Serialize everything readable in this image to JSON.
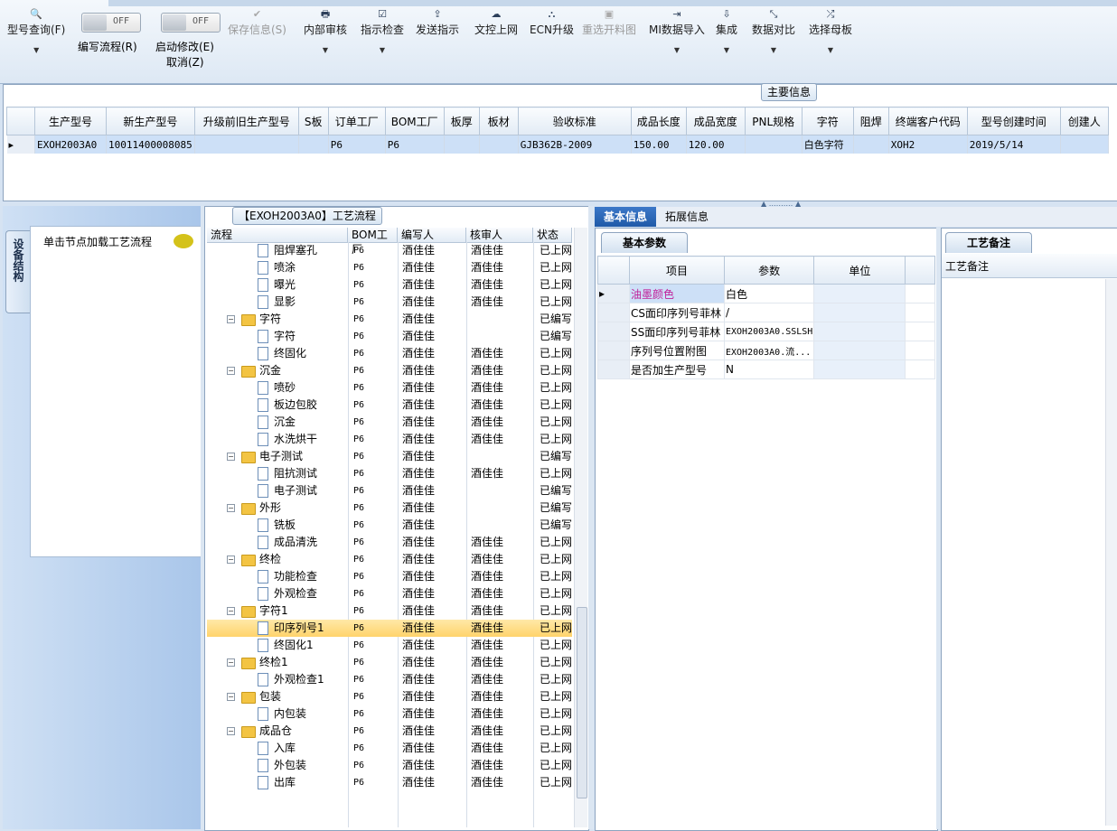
{
  "toolbar": {
    "buttons": [
      {
        "label": "型号查询(F)",
        "icon": "search-icon",
        "glyph": "🔍",
        "dropdown": true,
        "disabled": false
      },
      {
        "label": "保存信息(S)",
        "icon": "check-icon",
        "glyph": "✔",
        "dropdown": false,
        "disabled": true
      },
      {
        "label": "内部审核",
        "icon": "print-icon",
        "glyph": "🖶",
        "dropdown": true,
        "disabled": false
      },
      {
        "label": "指示检查",
        "icon": "checkbox-icon",
        "glyph": "☑",
        "dropdown": true,
        "disabled": false
      },
      {
        "label": "发送指示",
        "icon": "upload-icon",
        "glyph": "⇪",
        "dropdown": false,
        "disabled": false
      },
      {
        "label": "文控上网",
        "icon": "cloud-upload-icon",
        "glyph": "☁",
        "dropdown": false,
        "disabled": false
      },
      {
        "label": "ECN升级",
        "icon": "ecn-icon",
        "glyph": "⛬",
        "dropdown": false,
        "disabled": false
      },
      {
        "label": "重选开料图",
        "icon": "image-icon",
        "glyph": "▣",
        "dropdown": false,
        "disabled": true
      },
      {
        "label": "MI数据导入",
        "icon": "import-icon",
        "glyph": "⇥",
        "dropdown": true,
        "disabled": false
      },
      {
        "label": "集成",
        "icon": "download-icon",
        "glyph": "⇩",
        "dropdown": true,
        "disabled": false
      },
      {
        "label": "数据对比",
        "icon": "compress-icon",
        "glyph": "⤡",
        "dropdown": true,
        "disabled": false
      },
      {
        "label": "选择母板",
        "icon": "shuffle-icon",
        "glyph": "⤮",
        "dropdown": true,
        "disabled": false
      }
    ],
    "toggles": [
      {
        "state": "OFF",
        "label": "编写流程(R)"
      },
      {
        "state": "OFF",
        "label": "启动修改(E)",
        "sublabel": "取消(Z)"
      }
    ]
  },
  "main_info": {
    "group_title": "主要信息",
    "columns": [
      "生产型号",
      "新生产型号",
      "升级前旧生产型号",
      "S板",
      "订单工厂",
      "BOM工厂",
      "板厚",
      "板材",
      "验收标准",
      "成品长度",
      "成品宽度",
      "PNL规格",
      "字符",
      "阻焊",
      "终端客户代码",
      "型号创建时间",
      "创建人"
    ],
    "row": [
      "EXOH2003A0",
      "10011400008085",
      "",
      "",
      "P6",
      "P6",
      "",
      "",
      "GJB362B-2009",
      "150.00",
      "120.00",
      "",
      "白色字符",
      "",
      "XOH2",
      "2019/5/14",
      ""
    ]
  },
  "left_panel": {
    "vertical_tab": "设备结构",
    "hint": "单击节点加载工艺流程"
  },
  "process_tree": {
    "title": "【EXOH2003A0】工艺流程",
    "columns": [
      "流程",
      "BOM工厂",
      "编写人",
      "核审人",
      "状态"
    ],
    "rows": [
      {
        "name": "阻焊塞孔",
        "level": 2,
        "bom": "P6",
        "writer": "酒佳佳",
        "reviewer": "酒佳佳",
        "status": "已上网"
      },
      {
        "name": "喷涂",
        "level": 2,
        "bom": "P6",
        "writer": "酒佳佳",
        "reviewer": "酒佳佳",
        "status": "已上网"
      },
      {
        "name": "曝光",
        "level": 2,
        "bom": "P6",
        "writer": "酒佳佳",
        "reviewer": "酒佳佳",
        "status": "已上网"
      },
      {
        "name": "显影",
        "level": 2,
        "bom": "P6",
        "writer": "酒佳佳",
        "reviewer": "酒佳佳",
        "status": "已上网"
      },
      {
        "name": "字符",
        "level": 1,
        "bom": "P6",
        "writer": "酒佳佳",
        "reviewer": "",
        "status": "已编写"
      },
      {
        "name": "字符",
        "level": 2,
        "bom": "P6",
        "writer": "酒佳佳",
        "reviewer": "",
        "status": "已编写"
      },
      {
        "name": "终固化",
        "level": 2,
        "bom": "P6",
        "writer": "酒佳佳",
        "reviewer": "酒佳佳",
        "status": "已上网"
      },
      {
        "name": "沉金",
        "level": 1,
        "bom": "P6",
        "writer": "酒佳佳",
        "reviewer": "酒佳佳",
        "status": "已上网"
      },
      {
        "name": "喷砂",
        "level": 2,
        "bom": "P6",
        "writer": "酒佳佳",
        "reviewer": "酒佳佳",
        "status": "已上网"
      },
      {
        "name": "板边包胶",
        "level": 2,
        "bom": "P6",
        "writer": "酒佳佳",
        "reviewer": "酒佳佳",
        "status": "已上网"
      },
      {
        "name": "沉金",
        "level": 2,
        "bom": "P6",
        "writer": "酒佳佳",
        "reviewer": "酒佳佳",
        "status": "已上网"
      },
      {
        "name": "水洗烘干",
        "level": 2,
        "bom": "P6",
        "writer": "酒佳佳",
        "reviewer": "酒佳佳",
        "status": "已上网"
      },
      {
        "name": "电子测试",
        "level": 1,
        "bom": "P6",
        "writer": "酒佳佳",
        "reviewer": "",
        "status": "已编写"
      },
      {
        "name": "阻抗测试",
        "level": 2,
        "bom": "P6",
        "writer": "酒佳佳",
        "reviewer": "酒佳佳",
        "status": "已上网"
      },
      {
        "name": "电子测试",
        "level": 2,
        "bom": "P6",
        "writer": "酒佳佳",
        "reviewer": "",
        "status": "已编写"
      },
      {
        "name": "外形",
        "level": 1,
        "bom": "P6",
        "writer": "酒佳佳",
        "reviewer": "",
        "status": "已编写"
      },
      {
        "name": "铣板",
        "level": 2,
        "bom": "P6",
        "writer": "酒佳佳",
        "reviewer": "",
        "status": "已编写"
      },
      {
        "name": "成品清洗",
        "level": 2,
        "bom": "P6",
        "writer": "酒佳佳",
        "reviewer": "酒佳佳",
        "status": "已上网"
      },
      {
        "name": "终检",
        "level": 1,
        "bom": "P6",
        "writer": "酒佳佳",
        "reviewer": "酒佳佳",
        "status": "已上网"
      },
      {
        "name": "功能检查",
        "level": 2,
        "bom": "P6",
        "writer": "酒佳佳",
        "reviewer": "酒佳佳",
        "status": "已上网"
      },
      {
        "name": "外观检查",
        "level": 2,
        "bom": "P6",
        "writer": "酒佳佳",
        "reviewer": "酒佳佳",
        "status": "已上网"
      },
      {
        "name": "字符1",
        "level": 1,
        "bom": "P6",
        "writer": "酒佳佳",
        "reviewer": "酒佳佳",
        "status": "已上网"
      },
      {
        "name": "印序列号1",
        "level": 2,
        "bom": "P6",
        "writer": "酒佳佳",
        "reviewer": "酒佳佳",
        "status": "已上网",
        "selected": true
      },
      {
        "name": "终固化1",
        "level": 2,
        "bom": "P6",
        "writer": "酒佳佳",
        "reviewer": "酒佳佳",
        "status": "已上网"
      },
      {
        "name": "终检1",
        "level": 1,
        "bom": "P6",
        "writer": "酒佳佳",
        "reviewer": "酒佳佳",
        "status": "已上网"
      },
      {
        "name": "外观检查1",
        "level": 2,
        "bom": "P6",
        "writer": "酒佳佳",
        "reviewer": "酒佳佳",
        "status": "已上网"
      },
      {
        "name": "包装",
        "level": 1,
        "bom": "P6",
        "writer": "酒佳佳",
        "reviewer": "酒佳佳",
        "status": "已上网"
      },
      {
        "name": "内包装",
        "level": 2,
        "bom": "P6",
        "writer": "酒佳佳",
        "reviewer": "酒佳佳",
        "status": "已上网"
      },
      {
        "name": "成品仓",
        "level": 1,
        "bom": "P6",
        "writer": "酒佳佳",
        "reviewer": "酒佳佳",
        "status": "已上网"
      },
      {
        "name": "入库",
        "level": 2,
        "bom": "P6",
        "writer": "酒佳佳",
        "reviewer": "酒佳佳",
        "status": "已上网"
      },
      {
        "name": "外包装",
        "level": 2,
        "bom": "P6",
        "writer": "酒佳佳",
        "reviewer": "酒佳佳",
        "status": "已上网"
      },
      {
        "name": "出库",
        "level": 2,
        "bom": "P6",
        "writer": "酒佳佳",
        "reviewer": "酒佳佳",
        "status": "已上网"
      }
    ]
  },
  "right_panel": {
    "tabs": [
      "基本信息",
      "拓展信息"
    ],
    "basic_params_tab": "基本参数",
    "param_columns": [
      "项目",
      "参数",
      "单位"
    ],
    "params": [
      {
        "item": "油墨颜色",
        "value": "白色",
        "unit": "",
        "highlight": true
      },
      {
        "item": "CS面印序列号菲林",
        "value": "/",
        "unit": ""
      },
      {
        "item": "SS面印序列号菲林",
        "value": "EXOH2003A0.SSLSH",
        "unit": ""
      },
      {
        "item": "序列号位置附图",
        "value": "EXOH2003A0.流...",
        "unit": ""
      },
      {
        "item": "是否加生产型号",
        "value": "N",
        "unit": ""
      }
    ],
    "notes_tab": "工艺备注",
    "notes_header": "工艺备注"
  },
  "colors": {
    "highlight_item": "#c0209a",
    "selected_row": "#ffd36b",
    "accent_tab": "#1f5aa8"
  }
}
